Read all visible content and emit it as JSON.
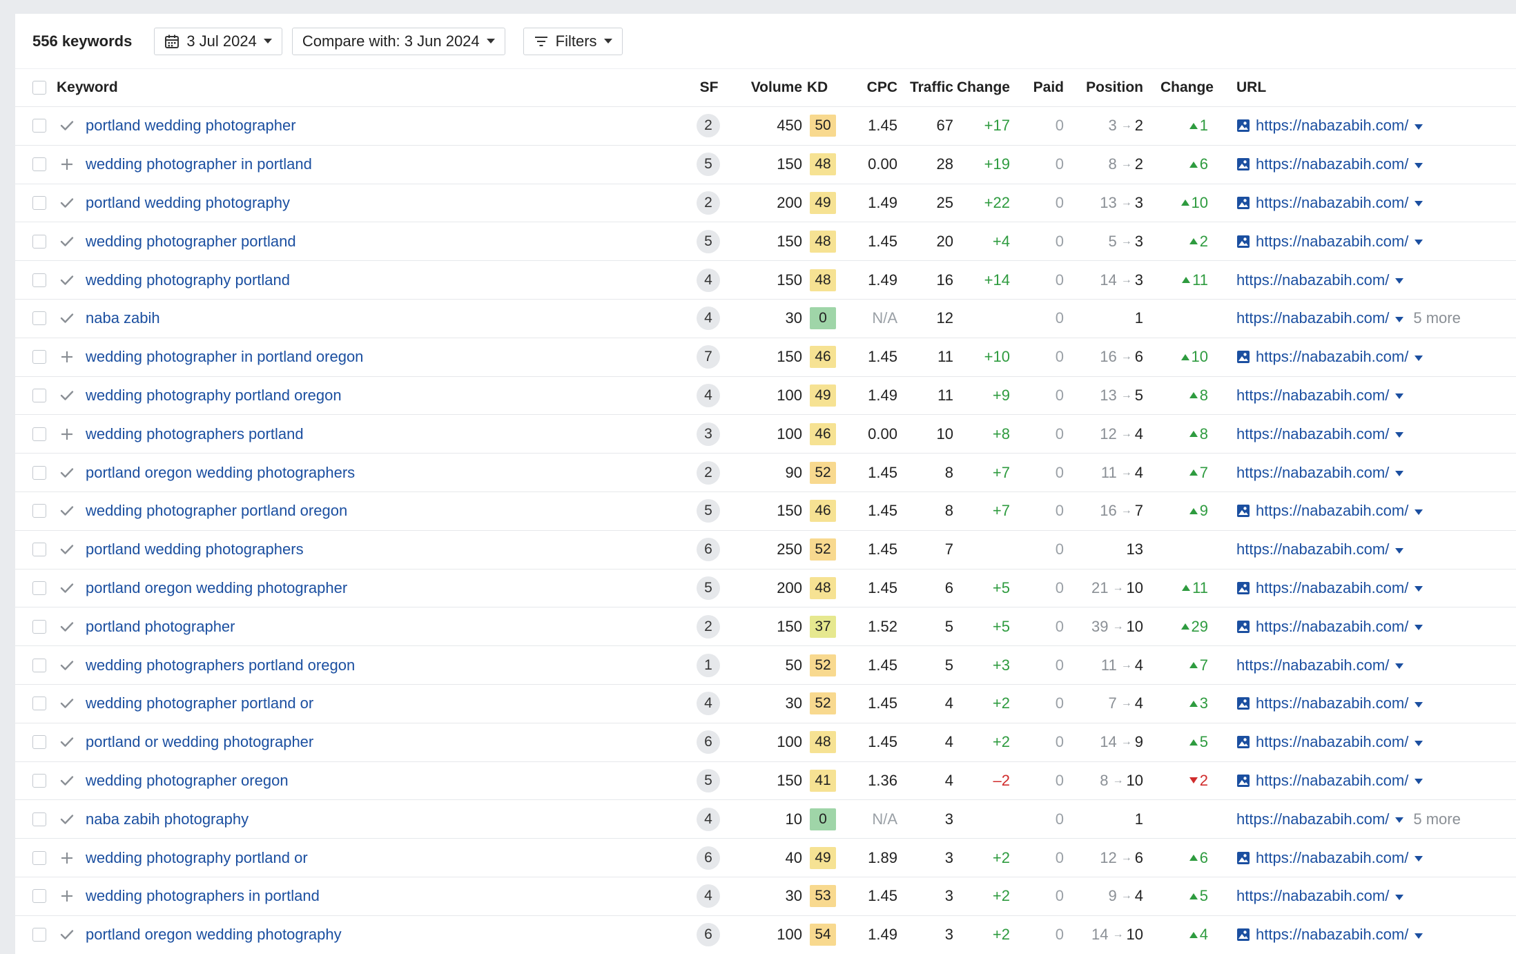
{
  "toolbar": {
    "count_label": "556 keywords",
    "date_label": "3 Jul 2024",
    "compare_label": "Compare with: 3 Jun 2024",
    "filters_label": "Filters"
  },
  "columns": {
    "keyword": "Keyword",
    "sf": "SF",
    "volume": "Volume",
    "kd": "KD",
    "cpc": "CPC",
    "traffic": "Traffic",
    "change": "Change",
    "paid": "Paid",
    "position": "Position",
    "pos_change": "Change",
    "url": "URL"
  },
  "kd_colors": {
    "zero": "#9fd5a8",
    "mid": "#e6e88f",
    "yellow": "#f6e293",
    "amber": "#f8d98f"
  },
  "rows": [
    {
      "action": "check",
      "keyword": "portland wedding photographer",
      "sf": "2",
      "volume": "450",
      "kd": "50",
      "cpc": "1.45",
      "traffic": "67",
      "change": "+17",
      "paid": "0",
      "pos_prev": "3",
      "pos": "2",
      "pos_change": "1",
      "dir": "up",
      "url": "https://nabazabih.com/",
      "img": true,
      "more": ""
    },
    {
      "action": "plus",
      "keyword": "wedding photographer in portland",
      "sf": "5",
      "volume": "150",
      "kd": "48",
      "cpc": "0.00",
      "traffic": "28",
      "change": "+19",
      "paid": "0",
      "pos_prev": "8",
      "pos": "2",
      "pos_change": "6",
      "dir": "up",
      "url": "https://nabazabih.com/",
      "img": true,
      "more": ""
    },
    {
      "action": "check",
      "keyword": "portland wedding photography",
      "sf": "2",
      "volume": "200",
      "kd": "49",
      "cpc": "1.49",
      "traffic": "25",
      "change": "+22",
      "paid": "0",
      "pos_prev": "13",
      "pos": "3",
      "pos_change": "10",
      "dir": "up",
      "url": "https://nabazabih.com/",
      "img": true,
      "more": ""
    },
    {
      "action": "check",
      "keyword": "wedding photographer portland",
      "sf": "5",
      "volume": "150",
      "kd": "48",
      "cpc": "1.45",
      "traffic": "20",
      "change": "+4",
      "paid": "0",
      "pos_prev": "5",
      "pos": "3",
      "pos_change": "2",
      "dir": "up",
      "url": "https://nabazabih.com/",
      "img": true,
      "more": ""
    },
    {
      "action": "check",
      "keyword": "wedding photography portland",
      "sf": "4",
      "volume": "150",
      "kd": "48",
      "cpc": "1.49",
      "traffic": "16",
      "change": "+14",
      "paid": "0",
      "pos_prev": "14",
      "pos": "3",
      "pos_change": "11",
      "dir": "up",
      "url": "https://nabazabih.com/",
      "img": false,
      "more": ""
    },
    {
      "action": "check",
      "keyword": "naba zabih",
      "sf": "4",
      "volume": "30",
      "kd": "0",
      "cpc": "N/A",
      "traffic": "12",
      "change": "",
      "paid": "0",
      "pos_prev": "",
      "pos": "1",
      "pos_change": "",
      "dir": "",
      "url": "https://nabazabih.com/",
      "img": false,
      "more": "5 more"
    },
    {
      "action": "plus",
      "keyword": "wedding photographer in portland oregon",
      "sf": "7",
      "volume": "150",
      "kd": "46",
      "cpc": "1.45",
      "traffic": "11",
      "change": "+10",
      "paid": "0",
      "pos_prev": "16",
      "pos": "6",
      "pos_change": "10",
      "dir": "up",
      "url": "https://nabazabih.com/",
      "img": true,
      "more": ""
    },
    {
      "action": "check",
      "keyword": "wedding photography portland oregon",
      "sf": "4",
      "volume": "100",
      "kd": "49",
      "cpc": "1.49",
      "traffic": "11",
      "change": "+9",
      "paid": "0",
      "pos_prev": "13",
      "pos": "5",
      "pos_change": "8",
      "dir": "up",
      "url": "https://nabazabih.com/",
      "img": false,
      "more": ""
    },
    {
      "action": "plus",
      "keyword": "wedding photographers portland",
      "sf": "3",
      "volume": "100",
      "kd": "46",
      "cpc": "0.00",
      "traffic": "10",
      "change": "+8",
      "paid": "0",
      "pos_prev": "12",
      "pos": "4",
      "pos_change": "8",
      "dir": "up",
      "url": "https://nabazabih.com/",
      "img": false,
      "more": ""
    },
    {
      "action": "check",
      "keyword": "portland oregon wedding photographers",
      "sf": "2",
      "volume": "90",
      "kd": "52",
      "cpc": "1.45",
      "traffic": "8",
      "change": "+7",
      "paid": "0",
      "pos_prev": "11",
      "pos": "4",
      "pos_change": "7",
      "dir": "up",
      "url": "https://nabazabih.com/",
      "img": false,
      "more": ""
    },
    {
      "action": "check",
      "keyword": "wedding photographer portland oregon",
      "sf": "5",
      "volume": "150",
      "kd": "46",
      "cpc": "1.45",
      "traffic": "8",
      "change": "+7",
      "paid": "0",
      "pos_prev": "16",
      "pos": "7",
      "pos_change": "9",
      "dir": "up",
      "url": "https://nabazabih.com/",
      "img": true,
      "more": ""
    },
    {
      "action": "check",
      "keyword": "portland wedding photographers",
      "sf": "6",
      "volume": "250",
      "kd": "52",
      "cpc": "1.45",
      "traffic": "7",
      "change": "",
      "paid": "0",
      "pos_prev": "",
      "pos": "13",
      "pos_change": "",
      "dir": "",
      "url": "https://nabazabih.com/",
      "img": false,
      "more": ""
    },
    {
      "action": "check",
      "keyword": "portland oregon wedding photographer",
      "sf": "5",
      "volume": "200",
      "kd": "48",
      "cpc": "1.45",
      "traffic": "6",
      "change": "+5",
      "paid": "0",
      "pos_prev": "21",
      "pos": "10",
      "pos_change": "11",
      "dir": "up",
      "url": "https://nabazabih.com/",
      "img": true,
      "more": ""
    },
    {
      "action": "check",
      "keyword": "portland photographer",
      "sf": "2",
      "volume": "150",
      "kd": "37",
      "cpc": "1.52",
      "traffic": "5",
      "change": "+5",
      "paid": "0",
      "pos_prev": "39",
      "pos": "10",
      "pos_change": "29",
      "dir": "up",
      "url": "https://nabazabih.com/",
      "img": true,
      "more": ""
    },
    {
      "action": "check",
      "keyword": "wedding photographers portland oregon",
      "sf": "1",
      "volume": "50",
      "kd": "52",
      "cpc": "1.45",
      "traffic": "5",
      "change": "+3",
      "paid": "0",
      "pos_prev": "11",
      "pos": "4",
      "pos_change": "7",
      "dir": "up",
      "url": "https://nabazabih.com/",
      "img": false,
      "more": ""
    },
    {
      "action": "check",
      "keyword": "wedding photographer portland or",
      "sf": "4",
      "volume": "30",
      "kd": "52",
      "cpc": "1.45",
      "traffic": "4",
      "change": "+2",
      "paid": "0",
      "pos_prev": "7",
      "pos": "4",
      "pos_change": "3",
      "dir": "up",
      "url": "https://nabazabih.com/",
      "img": true,
      "more": ""
    },
    {
      "action": "check",
      "keyword": "portland or wedding photographer",
      "sf": "6",
      "volume": "100",
      "kd": "48",
      "cpc": "1.45",
      "traffic": "4",
      "change": "+2",
      "paid": "0",
      "pos_prev": "14",
      "pos": "9",
      "pos_change": "5",
      "dir": "up",
      "url": "https://nabazabih.com/",
      "img": true,
      "more": ""
    },
    {
      "action": "check",
      "keyword": "wedding photographer oregon",
      "sf": "5",
      "volume": "150",
      "kd": "41",
      "cpc": "1.36",
      "traffic": "4",
      "change": "–2",
      "paid": "0",
      "pos_prev": "8",
      "pos": "10",
      "pos_change": "2",
      "dir": "down",
      "url": "https://nabazabih.com/",
      "img": true,
      "more": ""
    },
    {
      "action": "check",
      "keyword": "naba zabih photography",
      "sf": "4",
      "volume": "10",
      "kd": "0",
      "cpc": "N/A",
      "traffic": "3",
      "change": "",
      "paid": "0",
      "pos_prev": "",
      "pos": "1",
      "pos_change": "",
      "dir": "",
      "url": "https://nabazabih.com/",
      "img": false,
      "more": "5 more"
    },
    {
      "action": "plus",
      "keyword": "wedding photography portland or",
      "sf": "6",
      "volume": "40",
      "kd": "49",
      "cpc": "1.89",
      "traffic": "3",
      "change": "+2",
      "paid": "0",
      "pos_prev": "12",
      "pos": "6",
      "pos_change": "6",
      "dir": "up",
      "url": "https://nabazabih.com/",
      "img": true,
      "more": ""
    },
    {
      "action": "plus",
      "keyword": "wedding photographers in portland",
      "sf": "4",
      "volume": "30",
      "kd": "53",
      "cpc": "1.45",
      "traffic": "3",
      "change": "+2",
      "paid": "0",
      "pos_prev": "9",
      "pos": "4",
      "pos_change": "5",
      "dir": "up",
      "url": "https://nabazabih.com/",
      "img": false,
      "more": ""
    },
    {
      "action": "check",
      "keyword": "portland oregon wedding photography",
      "sf": "6",
      "volume": "100",
      "kd": "54",
      "cpc": "1.49",
      "traffic": "3",
      "change": "+2",
      "paid": "0",
      "pos_prev": "14",
      "pos": "10",
      "pos_change": "4",
      "dir": "up",
      "url": "https://nabazabih.com/",
      "img": true,
      "more": ""
    }
  ]
}
